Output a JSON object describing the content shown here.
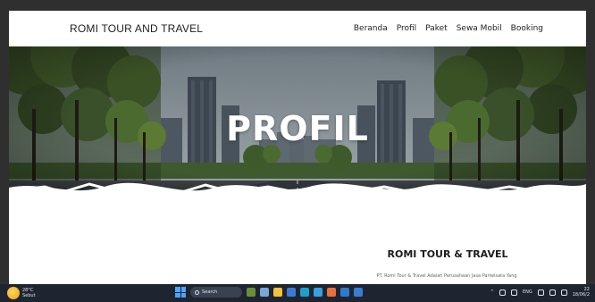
{
  "site": {
    "brand": "ROMI TOUR AND TRAVEL",
    "nav": [
      {
        "label": "Beranda"
      },
      {
        "label": "Profil"
      },
      {
        "label": "Paket"
      },
      {
        "label": "Sewa Mobil"
      },
      {
        "label": "Booking"
      }
    ]
  },
  "hero": {
    "title": "PROFIL"
  },
  "content": {
    "title": "ROMI TOUR & TRAVEL",
    "subtitle": "PT. Romi Tour & Travel Adalah Perusahaan Jasa Pariwisata Yang"
  },
  "taskbar": {
    "weather_temp": "28°C",
    "weather_cond": "Sebut",
    "search_label": "Search",
    "lang": "ENG",
    "time": "22",
    "date": "18/06/2"
  },
  "colors": {
    "taskbar": "#1f2530",
    "accent": "#4aa6ff"
  }
}
